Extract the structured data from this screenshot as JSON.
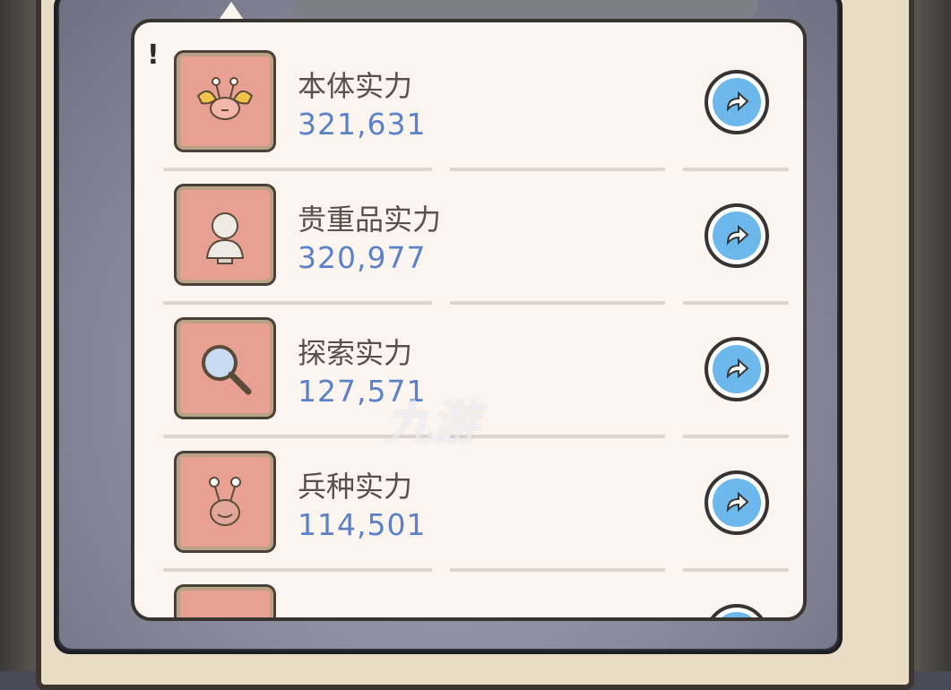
{
  "panel": {
    "rows": [
      {
        "label": "本体实力",
        "value": "321,631",
        "icon": "winged-snail-icon"
      },
      {
        "label": "贵重品实力",
        "value": "320,977",
        "icon": "bust-statue-icon"
      },
      {
        "label": "探索实力",
        "value": "127,571",
        "icon": "magnifier-icon"
      },
      {
        "label": "兵种实力",
        "value": "114,501",
        "icon": "snail-soldier-icon"
      },
      {
        "label": "",
        "value": "",
        "icon": "partial-icon"
      }
    ]
  },
  "watermark": {
    "text": "九游"
  },
  "colors": {
    "card_bg": "#fbf4ef",
    "icon_bg": "#e8a092",
    "value_text": "#5b82c8",
    "button_blue": "#6cb7ec"
  }
}
